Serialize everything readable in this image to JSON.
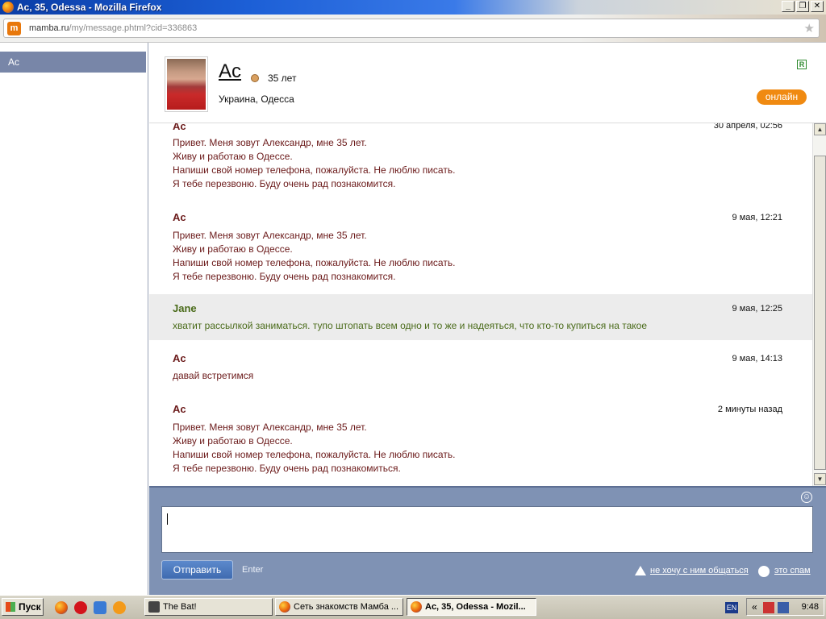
{
  "window": {
    "title": "Ac, 35, Odessa - Mozilla Firefox",
    "minimize": "_",
    "restore": "❐",
    "close": "✕"
  },
  "address": {
    "host": "mamba.ru",
    "path": "/my/message.phtml?cid=336863",
    "site_icon": "m"
  },
  "sidebar": {
    "items": [
      {
        "label": "Ac"
      }
    ]
  },
  "profile": {
    "name": "Ac",
    "age": "35 лет",
    "location": "Украина, Одесса",
    "real_badge": "R",
    "status": "онлайн"
  },
  "messages": [
    {
      "author": "Ac",
      "time": "30 апреля, 02:56",
      "text": "Привет. Меня зовут Александр, мне 35 лет.\nЖиву и работаю в Одессе.\nНапиши свой номер телефона, пожалуйста. Не люблю писать.\nЯ тебе перезвоню. Буду очень рад познакомится."
    },
    {
      "author": "Ac",
      "time": "9 мая, 12:21",
      "text": "Привет. Меня зовут Александр, мне 35 лет.\nЖиву и работаю в Одессе.\nНапиши свой номер телефона, пожалуйста. Не люблю писать.\nЯ тебе перезвоню. Буду очень рад познакомится."
    },
    {
      "author": "Jane",
      "time": "9 мая, 12:25",
      "text": "хватит рассылкой заниматься. тупо штопать всем одно и то же и надеяться, что кто-то купиться на такое"
    },
    {
      "author": "Ac",
      "time": "9 мая, 14:13",
      "text": "давай встретимся"
    },
    {
      "author": "Ac",
      "time": "2 минуты назад",
      "text": "Привет. Меня зовут Александр, мне 35 лет.\nЖиву и работаю в Одессе.\nНапиши свой номер телефона, пожалуйста. Не люблю писать.\nЯ тебе перезвоню. Буду очень рад познакомиться."
    }
  ],
  "composer": {
    "send_label": "Отправить",
    "enter_hint": "Enter",
    "block_label": "не хочу с ним общаться",
    "spam_label": "это спам",
    "smiley_icon": "smiley-icon"
  },
  "taskbar": {
    "start_label": "Пуск",
    "tasks": [
      {
        "label": "The Bat!"
      },
      {
        "label": "Сеть знакомств Мамба ..."
      },
      {
        "label": "Ac, 35, Odessa - Mozil..."
      }
    ],
    "language": "EN",
    "clock": "9:48"
  }
}
